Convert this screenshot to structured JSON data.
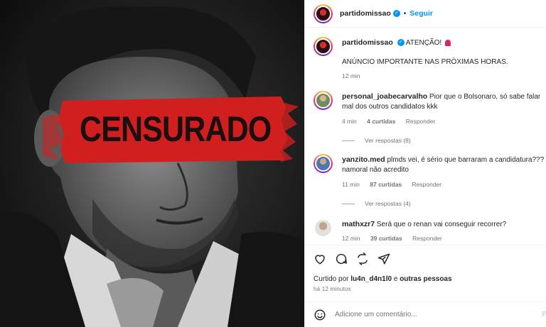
{
  "header": {
    "username": "partidomissao",
    "separator": "•",
    "follow_label": "Seguir"
  },
  "media": {
    "overlay_text": "CENSURADO"
  },
  "caption": {
    "username": "partidomissao",
    "text": "ATENÇÃO!",
    "announcement": "ANÚNCIO IMPORTANTE NAS PRÓXIMAS HORAS.",
    "time": "12 min"
  },
  "comments": [
    {
      "username": "personal_joabecarvalho",
      "text": "Pior que o Bolsonaro, só sabe falar mal dos outros candidatos kkk",
      "time": "4 min",
      "likes": "4 curtidas",
      "reply_label": "Responder",
      "view_replies": "Ver respostas (8)"
    },
    {
      "username": "yanzito.med",
      "text": "plmds vei, é sério que barraram a candidatura??? namoral não acredito",
      "time": "11 min",
      "likes": "87 curtidas",
      "reply_label": "Responder",
      "view_replies": "Ver respostas (4)"
    },
    {
      "username": "mathxzr7",
      "text": "Será que o renan vai conseguir recorrer?",
      "time": "12 min",
      "likes": "39 curtidas",
      "reply_label": "Responder"
    }
  ],
  "actions": {
    "icons": [
      "heart-icon",
      "comment-icon",
      "share-icon",
      "send-icon"
    ]
  },
  "likes_line": {
    "prefix": "Curtido por",
    "user": "lu4n_d4n1l0",
    "connector": "e",
    "others": "outras pessoas"
  },
  "posted_ago": "há 12 minutos",
  "add_comment": {
    "placeholder": "Adicione um comentário...",
    "publish_label": "P"
  },
  "colors": {
    "accent": "#0095f6",
    "censor_red": "#d11f1f",
    "muted": "#737373"
  }
}
